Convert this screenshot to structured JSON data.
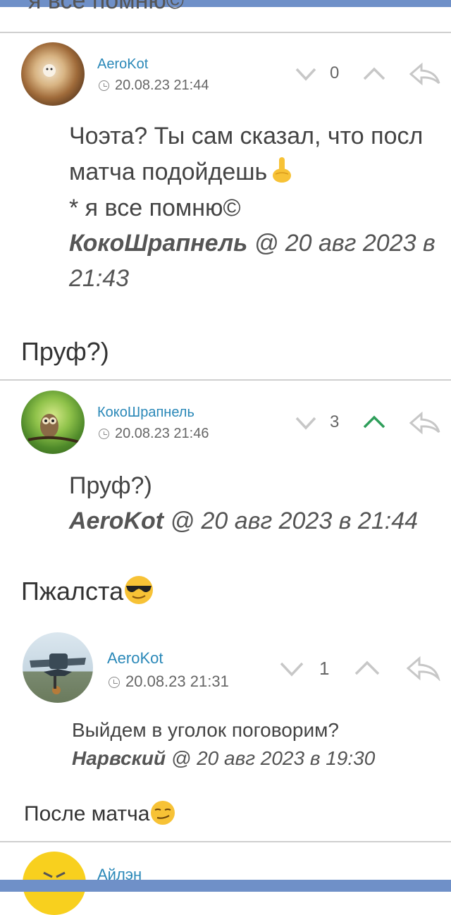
{
  "top_cut_text": "я все помню©",
  "comments": [
    {
      "username": "AeroKot",
      "date": "20.08.23 21:44",
      "score": "0",
      "text_line1": "Чоэта? Ты сам сказал, что посл",
      "text_line2": "матча подойдешь",
      "text_line3": "* я все помню©",
      "quote_author": "КокоШрапнель",
      "quote_meta": " @ 20 авг 2023 в",
      "quote_time": "21:43",
      "reply": "Пруф?)"
    },
    {
      "username": "КокоШрапнель",
      "date": "20.08.23 21:46",
      "score": "3",
      "text_line1": "Пруф?)",
      "quote_author": "AeroKot",
      "quote_meta": " @ 20 авг 2023 в 21:44",
      "reply": "Пжалста"
    },
    {
      "username": "AeroKot",
      "date": "20.08.23 21:31",
      "score": "1",
      "text_line1": "Выйдем в уголок поговорим?",
      "quote_author": "Нарвский",
      "quote_meta": " @ 20 авг 2023 в 19:30",
      "reply": "После матча"
    },
    {
      "username": "Айлэн"
    }
  ],
  "colors": {
    "accent": "#2a88b8",
    "upvote_active": "#2e9e5a",
    "bar": "#6f90c8"
  }
}
